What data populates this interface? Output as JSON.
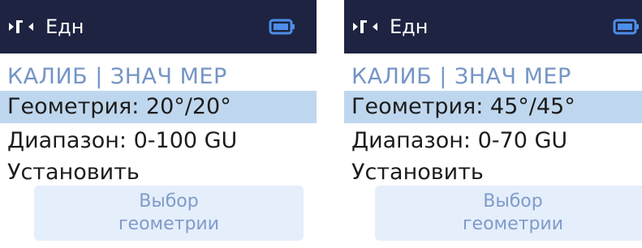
{
  "colors": {
    "header_bg": "#1d2340",
    "battery": "#4d8ee8",
    "title": "#7595c5",
    "selected_row": "#bfd7ee",
    "button_bg": "#e5eefb",
    "button_text": "#7f9cc9"
  },
  "screens": [
    {
      "header": {
        "nav_icon": "play-back-icon",
        "unit_label": "Едн",
        "battery_icon": "battery-icon"
      },
      "menu": {
        "title": "КАЛИБ | ЗНАЧ МЕР",
        "items": [
          {
            "label": "Геометрия: 20°/20°",
            "selected": true
          },
          {
            "label": "Диапазон: 0-100 GU",
            "selected": false
          },
          {
            "label": "Установить",
            "selected": false
          }
        ]
      },
      "button": {
        "line1": "Выбор",
        "line2": "геометрии"
      }
    },
    {
      "header": {
        "nav_icon": "play-back-icon",
        "unit_label": "Едн",
        "battery_icon": "battery-icon"
      },
      "menu": {
        "title": "КАЛИБ | ЗНАЧ МЕР",
        "items": [
          {
            "label": "Геометрия: 45°/45°",
            "selected": true
          },
          {
            "label": "Диапазон: 0-70 GU",
            "selected": false
          },
          {
            "label": "Установить",
            "selected": false
          }
        ]
      },
      "button": {
        "line1": "Выбор",
        "line2": "геометрии"
      }
    }
  ]
}
